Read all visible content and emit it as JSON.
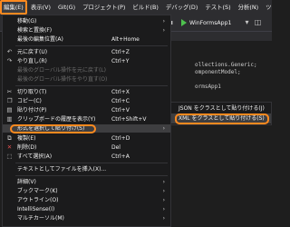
{
  "menubar": {
    "items": [
      "編集(E)",
      "表示(V)",
      "Git(G)",
      "プロジェクト(P)",
      "ビルド(B)",
      "デバッグ(D)",
      "テスト(S)",
      "分析(N)",
      "ツール(T)",
      "拡張"
    ]
  },
  "toolbar": {
    "run_label": "WinFormsApp1"
  },
  "code": {
    "line1": "ollections.Generic;",
    "line2": "omponentModel;",
    "line3": "ormsApp1"
  },
  "edit_menu": {
    "items": [
      {
        "label": "移動(G)",
        "shortcut": "",
        "arrow": "›"
      },
      {
        "label": "検索と置換(F)",
        "shortcut": "",
        "arrow": "›"
      },
      {
        "label": "最後の編集位置(A)",
        "shortcut": "Alt+Home",
        "arrow": ""
      },
      {
        "label": "元に戻す(U)",
        "shortcut": "Ctrl+Z",
        "arrow": ""
      },
      {
        "label": "やり直し(R)",
        "shortcut": "Ctrl+Y",
        "arrow": ""
      },
      {
        "label": "最後のグローバル操作を元に戻す(L)",
        "shortcut": "",
        "arrow": ""
      },
      {
        "label": "最後のグローバル操作をやり直す(O)",
        "shortcut": "",
        "arrow": ""
      },
      {
        "label": "切り取り(T)",
        "shortcut": "Ctrl+X",
        "arrow": ""
      },
      {
        "label": "コピー(C)",
        "shortcut": "Ctrl+C",
        "arrow": ""
      },
      {
        "label": "貼り付け(P)",
        "shortcut": "Ctrl+V",
        "arrow": ""
      },
      {
        "label": "クリップボードの履歴を表示(Y)",
        "shortcut": "Ctrl+Shift+V",
        "arrow": ""
      },
      {
        "label": "形式を選択して貼り付け(S)",
        "shortcut": "",
        "arrow": "›"
      },
      {
        "label": "複製(E)",
        "shortcut": "Ctrl+D",
        "arrow": ""
      },
      {
        "label": "削除(D)",
        "shortcut": "Del",
        "arrow": ""
      },
      {
        "label": "すべて選択(A)",
        "shortcut": "Ctrl+A",
        "arrow": ""
      },
      {
        "label": "テキストとしてファイルを挿入(X)...",
        "shortcut": "",
        "arrow": ""
      },
      {
        "label": "詳細(V)",
        "shortcut": "",
        "arrow": "›"
      },
      {
        "label": "ブックマーク(K)",
        "shortcut": "",
        "arrow": "›"
      },
      {
        "label": "アウトライン(O)",
        "shortcut": "",
        "arrow": "›"
      },
      {
        "label": "IntelliSense(I)",
        "shortcut": "",
        "arrow": "›"
      },
      {
        "label": "マルチカーソル(M)",
        "shortcut": "",
        "arrow": "›"
      }
    ]
  },
  "submenu": {
    "items": [
      {
        "label": "JSON をクラスとして貼り付ける(J)"
      },
      {
        "label": "XML をクラスとして貼り付ける(S)"
      }
    ]
  },
  "colors": {
    "highlight_frame": "#ff8a1f",
    "menu_bg": "#1b1b1c",
    "hover_bg": "#3e3e40",
    "run_icon": "#4ec24e"
  },
  "icons": {
    "undo": "undo-icon",
    "redo": "redo-icon",
    "cut": "scissors-icon",
    "copy": "copy-icon",
    "paste": "paste-icon",
    "clipboard_history": "clipboard-icon",
    "delete": "delete-x-icon",
    "select_all": "select-all-icon"
  }
}
